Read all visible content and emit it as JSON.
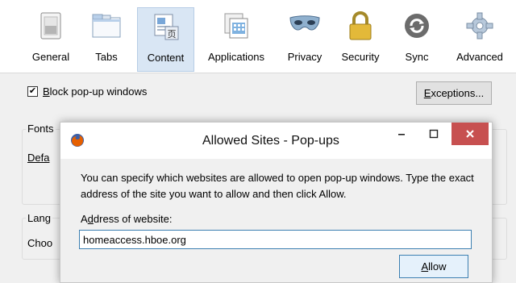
{
  "toolbar": {
    "items": [
      {
        "label": "General",
        "icon": "general-switch-icon"
      },
      {
        "label": "Tabs",
        "icon": "tabs-window-icon"
      },
      {
        "label": "Content",
        "icon": "content-page-icon",
        "active": true
      },
      {
        "label": "Applications",
        "icon": "applications-icon"
      },
      {
        "label": "Privacy",
        "icon": "privacy-mask-icon"
      },
      {
        "label": "Security",
        "icon": "security-lock-icon"
      },
      {
        "label": "Sync",
        "icon": "sync-icon"
      },
      {
        "label": "Advanced",
        "icon": "advanced-gear-icon"
      }
    ]
  },
  "content": {
    "block_popups": {
      "checked": true,
      "label_rest": "lock pop-up windows",
      "label_access": "B"
    },
    "exceptions_button": {
      "label_access": "E",
      "label_rest": "xceptions..."
    },
    "fonts_group_label": "Fonts",
    "default_font_label": "Defa",
    "languages_group_label": "Lang",
    "choose_label": "Choo"
  },
  "dialog": {
    "title": "Allowed Sites - Pop-ups",
    "description": "You can specify which websites are allowed to open pop-up windows. Type the exact address of the site you want to allow and then click Allow.",
    "address_label_pre": "A",
    "address_label_access": "d",
    "address_label_rest": "dress of website:",
    "address_value": "homeaccess.hboe.org",
    "allow_button": {
      "label_access": "A",
      "label_rest": "llow"
    }
  },
  "colors": {
    "accent": "#3c7fb1",
    "close": "#c75050",
    "active_tab": "#d9e6f4"
  }
}
